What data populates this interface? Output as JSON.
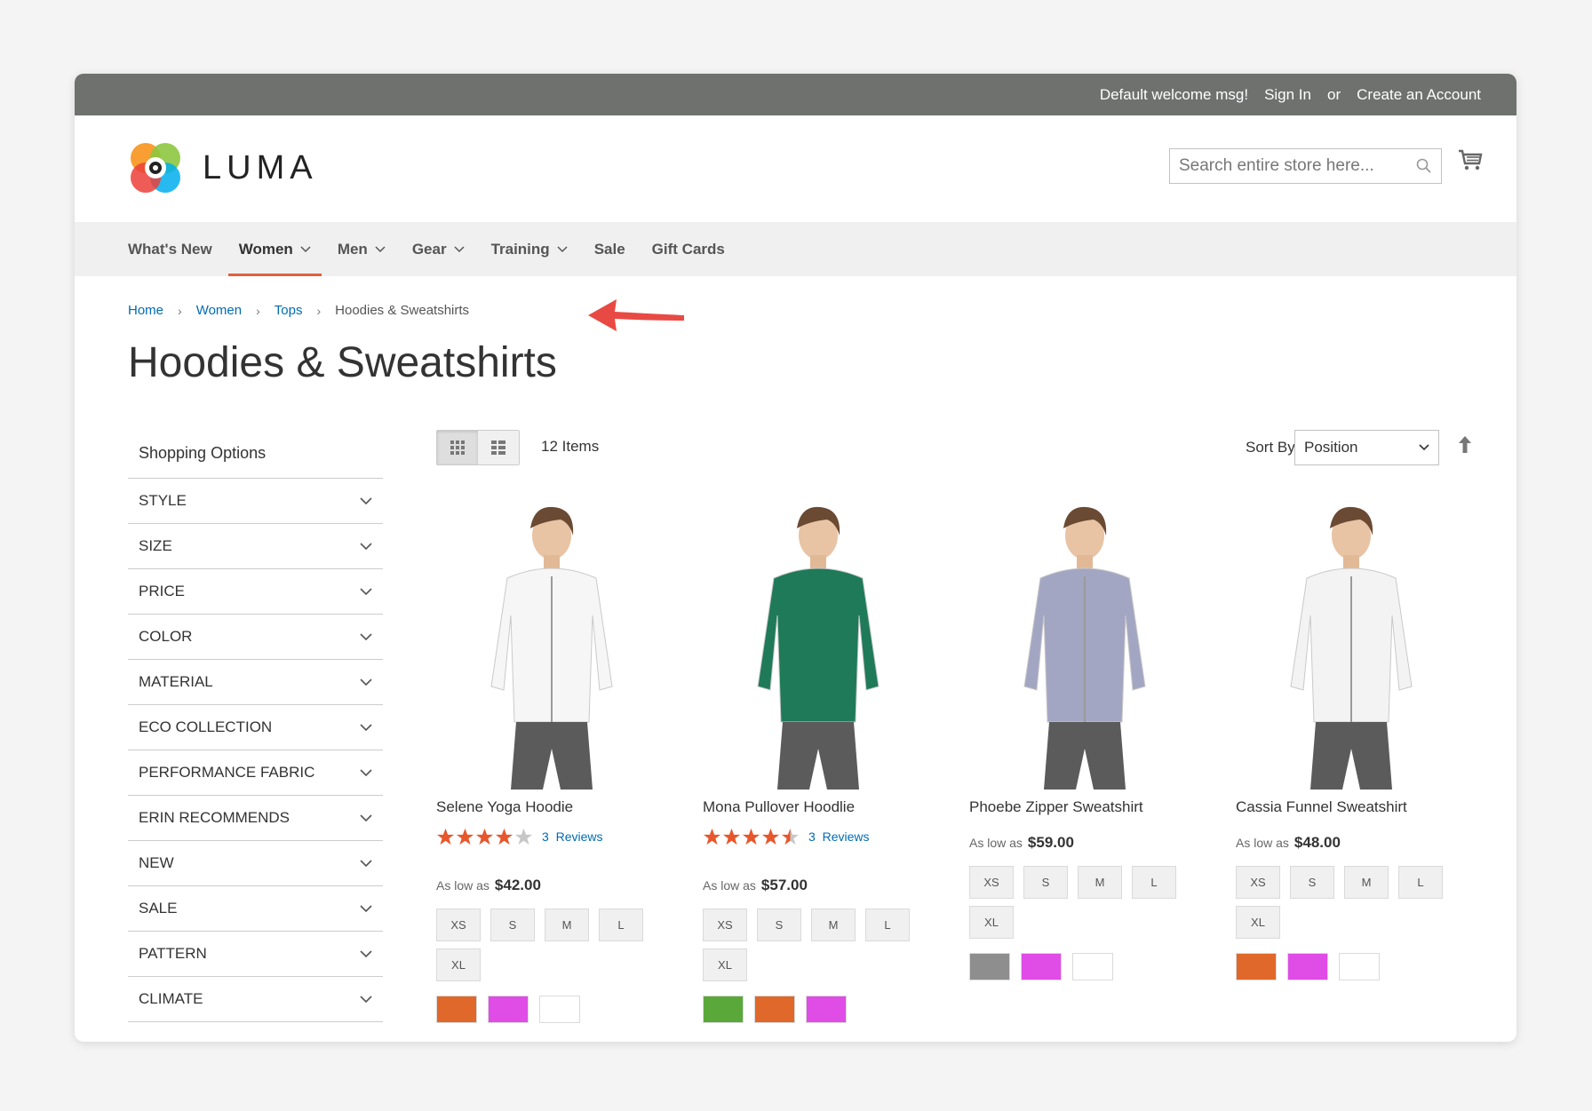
{
  "topbar": {
    "welcome": "Default welcome msg!",
    "signin": "Sign In",
    "or": "or",
    "create": "Create an Account"
  },
  "header": {
    "logo_text": "LUMA",
    "search_placeholder": "Search entire store here...",
    "icons": [
      "search-icon",
      "cart-icon"
    ]
  },
  "nav": {
    "items": [
      "What's New",
      "Women",
      "Men",
      "Gear",
      "Training",
      "Sale",
      "Gift Cards"
    ],
    "active": "Women"
  },
  "breadcrumb": [
    "Home",
    "Women",
    "Tops",
    "Hoodies & Sweatshirts"
  ],
  "page_title": "Hoodies & Sweatshirts",
  "sidebar": {
    "title": "Shopping Options",
    "filters": [
      "STYLE",
      "SIZE",
      "PRICE",
      "COLOR",
      "MATERIAL",
      "ECO COLLECTION",
      "PERFORMANCE FABRIC",
      "ERIN RECOMMENDS",
      "NEW",
      "SALE",
      "PATTERN",
      "CLIMATE"
    ]
  },
  "toolbar": {
    "amount": "12 Items",
    "sort_label": "Sort By",
    "sort_value": "Position",
    "view_modes": [
      "grid",
      "list"
    ]
  },
  "colors": {
    "accent": "#e35f3c",
    "link": "#006bb4",
    "star": "#e8562c",
    "topbar": "#6e716e"
  },
  "products": [
    {
      "name": "Selene Yoga Hoodie",
      "rating": 4,
      "reviews_count": "3",
      "reviews_label": "Reviews",
      "price_prefix": "As low as",
      "price": "$42.00",
      "sizes": [
        "XS",
        "S",
        "M",
        "L",
        "XL"
      ],
      "swatches": [
        "#e0682a",
        "#e04ce6",
        "#ffffff"
      ],
      "garment_color": "#f6f6f6"
    },
    {
      "name": "Mona Pullover Hoodlie",
      "rating": 4.5,
      "reviews_count": "3",
      "reviews_label": "Reviews",
      "price_prefix": "As low as",
      "price": "$57.00",
      "sizes": [
        "XS",
        "S",
        "M",
        "L",
        "XL"
      ],
      "swatches": [
        "#5aa83a",
        "#e0682a",
        "#e04ce6"
      ],
      "garment_color": "#1f7a5a"
    },
    {
      "name": "Phoebe Zipper Sweatshirt",
      "rating": 0,
      "reviews_count": "",
      "reviews_label": "",
      "price_prefix": "As low as",
      "price": "$59.00",
      "sizes": [
        "XS",
        "S",
        "M",
        "L",
        "XL"
      ],
      "swatches": [
        "#8e8e8e",
        "#e04ce6",
        "#ffffff"
      ],
      "garment_color": "#a3a6c2"
    },
    {
      "name": "Cassia Funnel Sweatshirt",
      "rating": 0,
      "reviews_count": "",
      "reviews_label": "",
      "price_prefix": "As low as",
      "price": "$48.00",
      "sizes": [
        "XS",
        "S",
        "M",
        "L",
        "XL"
      ],
      "swatches": [
        "#e0682a",
        "#e04ce6",
        "#ffffff"
      ],
      "garment_color": "#f3f3f3"
    }
  ]
}
